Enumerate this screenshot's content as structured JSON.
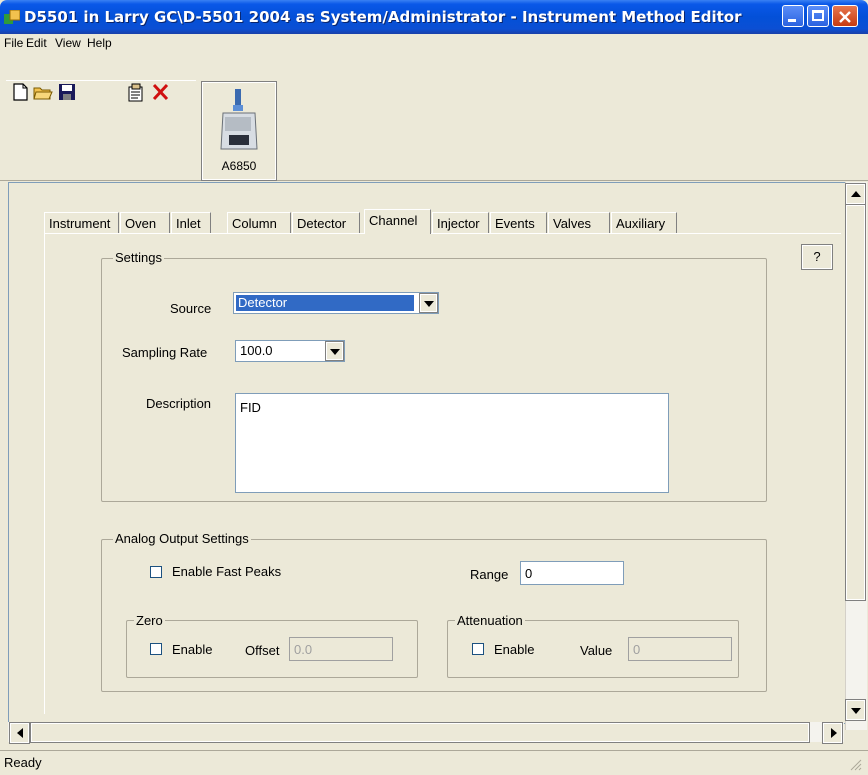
{
  "window": {
    "title": "D5501 in Larry GC\\D-5501 2004 as System/Administrator - Instrument Method Editor"
  },
  "menu": {
    "file": "File",
    "edit": "Edit",
    "view": "View",
    "help": "Help"
  },
  "toolbar": {
    "instrument_label": "A6850"
  },
  "tabs": [
    {
      "label": "Instrument"
    },
    {
      "label": "Oven"
    },
    {
      "label": "Inlet"
    },
    {
      "label": "Column"
    },
    {
      "label": "Detector"
    },
    {
      "label": "Channel"
    },
    {
      "label": "Injector"
    },
    {
      "label": "Events"
    },
    {
      "label": "Valves"
    },
    {
      "label": "Auxiliary"
    }
  ],
  "active_tab": "Channel",
  "help_button": "?",
  "settings": {
    "group_label": "Settings",
    "source_label": "Source",
    "source_value": "Detector",
    "sampling_rate_label": "Sampling Rate",
    "sampling_rate_value": "100.0",
    "description_label": "Description",
    "description_value": "FID"
  },
  "analog": {
    "group_label": "Analog Output Settings",
    "enable_fast_peaks_label": "Enable Fast Peaks",
    "range_label": "Range",
    "range_value": "0",
    "zero": {
      "group_label": "Zero",
      "enable_label": "Enable",
      "offset_label": "Offset",
      "offset_value": "0.0"
    },
    "attenuation": {
      "group_label": "Attenuation",
      "enable_label": "Enable",
      "value_label": "Value",
      "value_value": "0"
    }
  },
  "status": {
    "text": "Ready"
  },
  "colors": {
    "title_bar": "#0350d8",
    "selection": "#316ac5",
    "face": "#ece9d8"
  }
}
